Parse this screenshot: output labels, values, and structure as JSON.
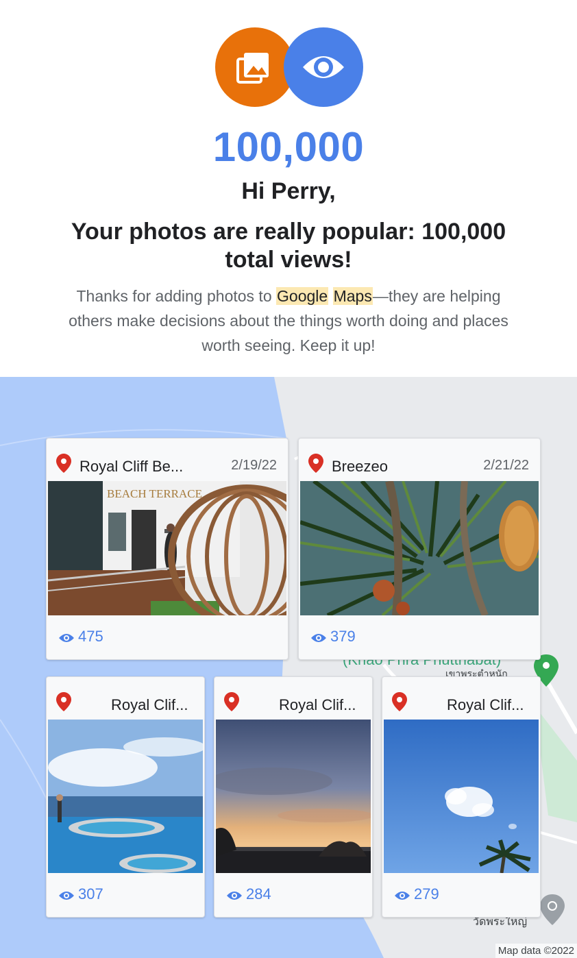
{
  "header": {
    "big_number": "100,000",
    "greeting": "Hi Perry,",
    "headline": "Your photos are really popular: 100,000 total views!",
    "body_before": "Thanks for adding photos to ",
    "body_hl1": "Google",
    "body_space": " ",
    "body_hl2": "Maps",
    "body_after": "—they are helping others make decisions about the things worth doing and places worth seeing. Keep it up!",
    "badges": [
      {
        "icon": "photo-library-icon",
        "color": "#e8710a"
      },
      {
        "icon": "eye-icon",
        "color": "#4a80e8"
      }
    ]
  },
  "map": {
    "attribution": "Map data ©2022",
    "labels": [
      "(Khao Phra Phutthabat)",
      "เขาพระตำหนัก",
      "วัดพระใหญ่"
    ]
  },
  "cards": [
    {
      "name": "Royal Cliff Be...",
      "date": "2/19/22",
      "views": "475",
      "photo": "beach-terrace-photo"
    },
    {
      "name": "Breezeo",
      "date": "2/21/22",
      "views": "379",
      "photo": "pandanus-tree-photo"
    },
    {
      "name": "Royal Clif...",
      "date": "",
      "views": "307",
      "photo": "infinity-pool-photo"
    },
    {
      "name": "Royal Clif...",
      "date": "",
      "views": "284",
      "photo": "sunset-sea-photo"
    },
    {
      "name": "Royal Clif...",
      "date": "",
      "views": "279",
      "photo": "blue-sky-palm-photo"
    }
  ],
  "colors": {
    "accent_blue": "#4a80e8",
    "accent_orange": "#e8710a",
    "pin_red": "#d93025",
    "highlight": "#fce8b2"
  }
}
